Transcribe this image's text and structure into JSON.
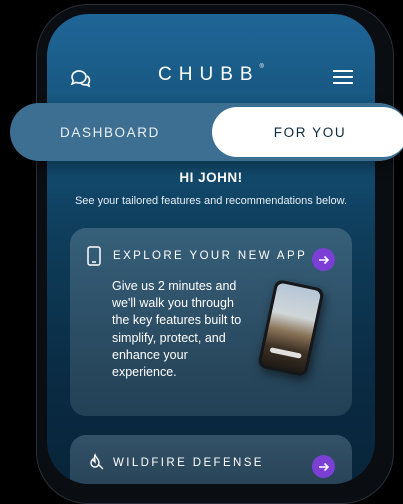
{
  "header": {
    "logo_text": "CHUBB",
    "logo_mark": "®",
    "chat_icon": "chat-bubbles-icon",
    "menu_icon": "hamburger-menu-icon"
  },
  "tabs": [
    {
      "label": "DASHBOARD",
      "active": false
    },
    {
      "label": "FOR YOU",
      "active": true
    }
  ],
  "greeting": "HI JOHN!",
  "subtitle": "See your tailored features and recommendations below.",
  "cards": [
    {
      "icon": "smartphone-icon",
      "title": "EXPLORE YOUR NEW APP",
      "body": "Give us 2 minutes and we'll walk you through the key features built to simplify, protect, and enhance your experience.",
      "button_icon": "arrow-right-icon"
    },
    {
      "icon": "fire-shield-icon",
      "title": "WILDFIRE DEFENSE",
      "button_icon": "arrow-right-icon"
    }
  ],
  "colors": {
    "accent": "#7b3fd6",
    "toggle_bg": "#3d6f92",
    "screen_top": "#1f6597",
    "screen_bottom": "#08243a"
  }
}
